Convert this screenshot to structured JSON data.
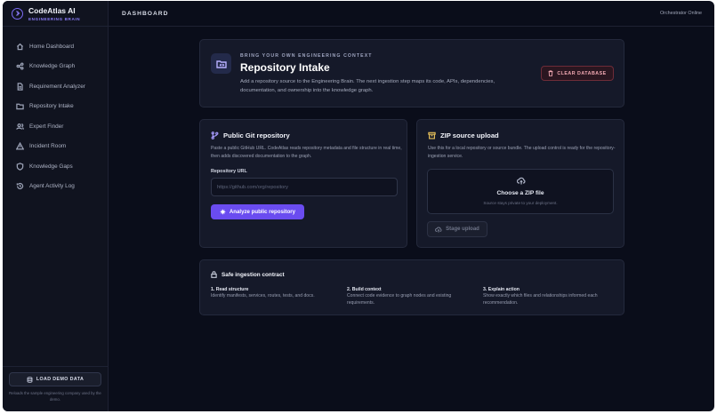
{
  "brand": {
    "title": "CodeAtlas AI",
    "subtitle": "ENGINEERING BRAIN"
  },
  "sidebar": {
    "items": [
      {
        "label": "Home Dashboard",
        "icon": "home-icon"
      },
      {
        "label": "Knowledge Graph",
        "icon": "share-nodes-icon"
      },
      {
        "label": "Requirement Analyzer",
        "icon": "document-icon"
      },
      {
        "label": "Repository Intake",
        "icon": "folder-code-icon"
      },
      {
        "label": "Expert Finder",
        "icon": "users-icon"
      },
      {
        "label": "Incident Room",
        "icon": "warning-triangle-icon"
      },
      {
        "label": "Knowledge Gaps",
        "icon": "shield-icon"
      },
      {
        "label": "Agent Activity Log",
        "icon": "history-icon"
      }
    ],
    "demo_button": "LOAD DEMO DATA",
    "demo_note": "Reloads the sample engineering company used by the demo."
  },
  "topbar": {
    "title": "DASHBOARD",
    "status": "Orchestrator Online"
  },
  "hero": {
    "kicker": "BRING YOUR OWN ENGINEERING CONTEXT",
    "title": "Repository Intake",
    "description": "Add a repository source to the Engineering Brain. The next ingestion step maps its code, APIs, dependencies, documentation, and ownership into the knowledge graph.",
    "clear_button": "CLEAR DATABASE"
  },
  "git_card": {
    "title": "Public Git repository",
    "description": "Paste a public GitHub URL. CodeAtlas reads repository metadata and file structure in real time, then adds discovered documentation to the graph.",
    "field_label": "Repository URL",
    "placeholder": "https://github.com/org/repository",
    "value": "",
    "button": "Analyze public repository"
  },
  "zip_card": {
    "title": "ZIP source upload",
    "description": "Use this for a local repository or source bundle. The upload control is ready for the repository-ingestion service.",
    "drop_title": "Choose a ZIP file",
    "drop_sub": "Source stays private to your deployment.",
    "button": "Stage upload"
  },
  "contract": {
    "title": "Safe ingestion contract",
    "steps": [
      {
        "title": "1. Read structure",
        "description": "Identify manifests, services, routes, tests, and docs."
      },
      {
        "title": "2. Build context",
        "description": "Connect code evidence to graph nodes and existing requirements."
      },
      {
        "title": "3. Explain action",
        "description": "Show exactly which files and relationships informed each recommendation."
      }
    ]
  },
  "colors": {
    "accent": "#6a4cf0",
    "danger": "#f2a9b3",
    "background": "#0a0d1a",
    "panel": "#151929"
  }
}
